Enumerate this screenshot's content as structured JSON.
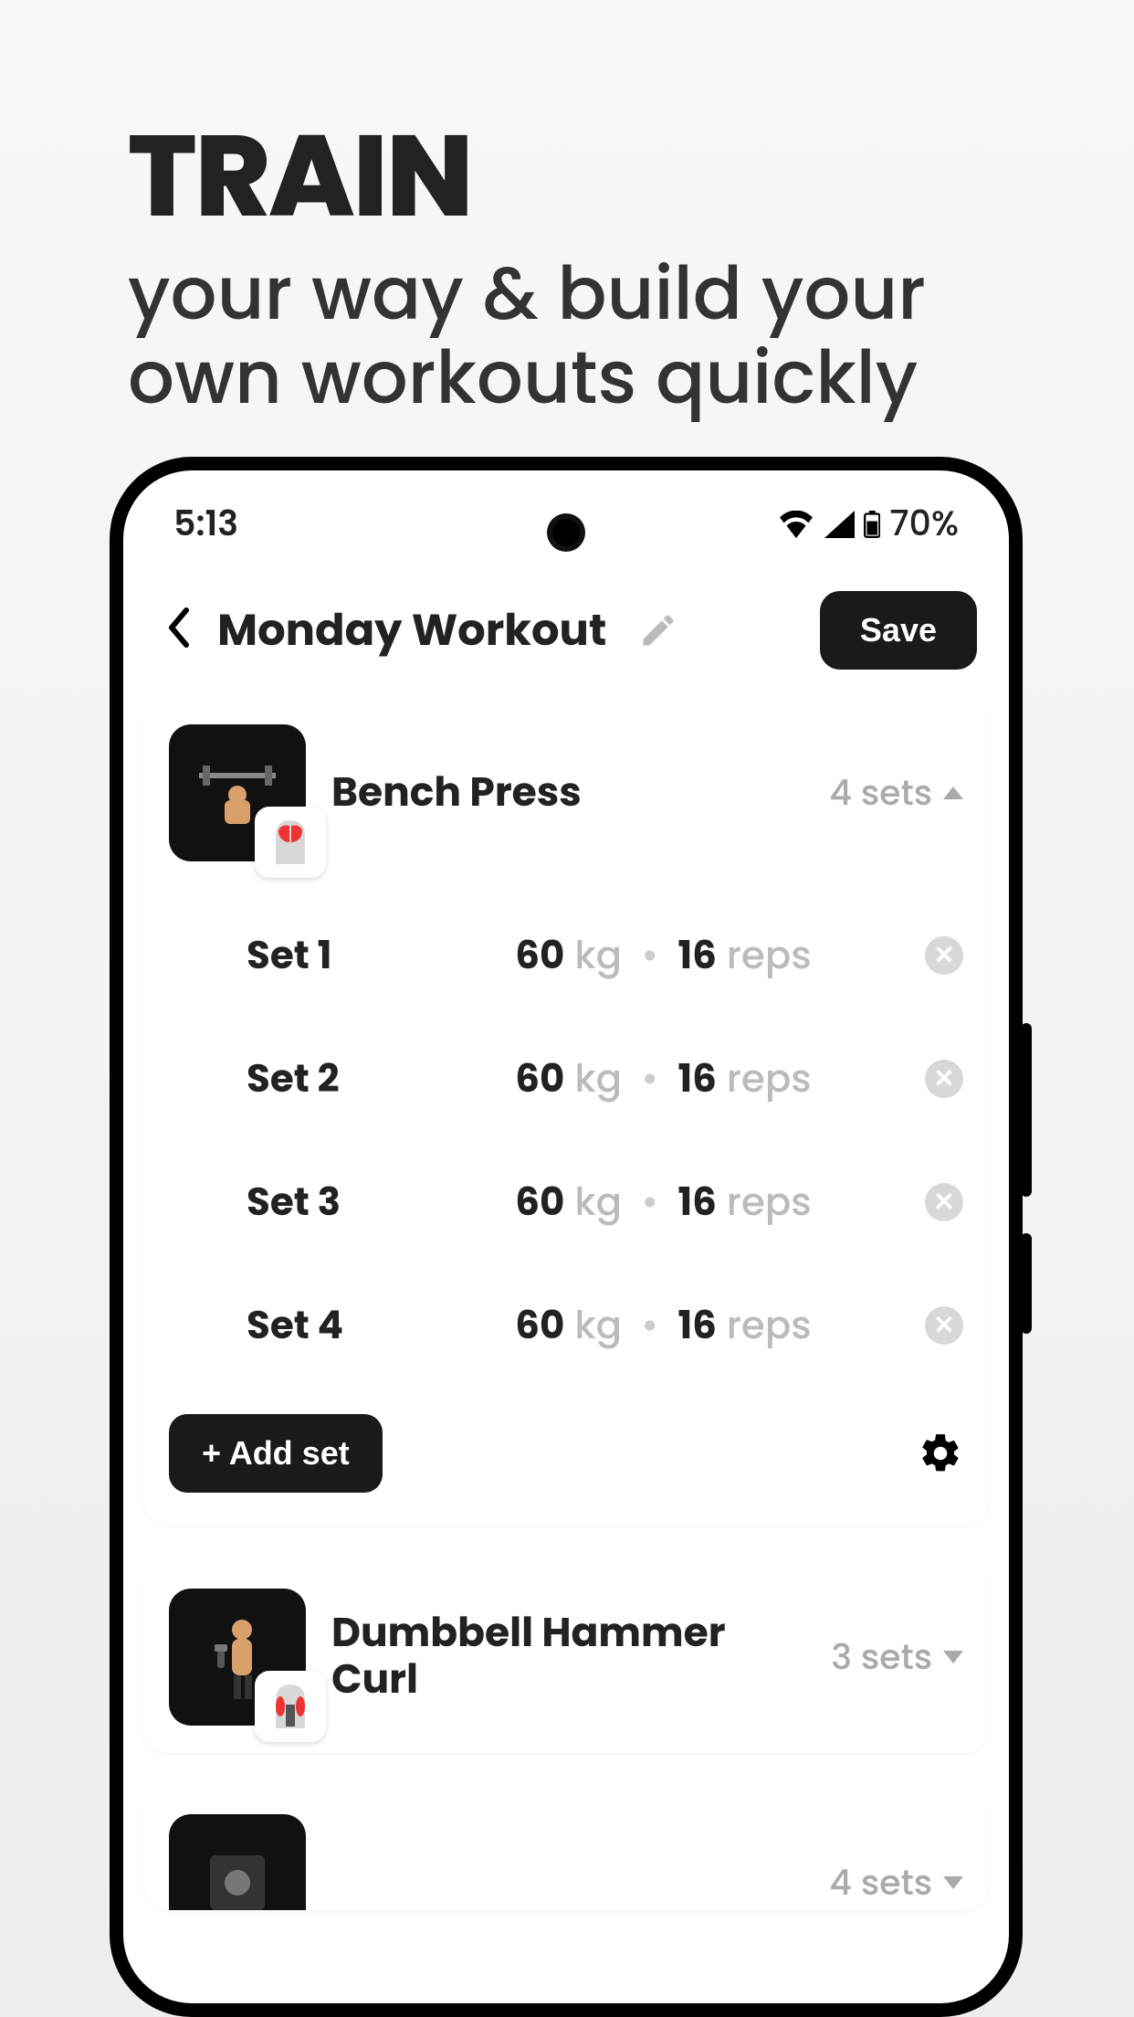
{
  "marketing": {
    "headline": "TRAIN",
    "subline": "your way & build your own workouts quickly"
  },
  "statusbar": {
    "time": "5:13",
    "battery": "70%"
  },
  "header": {
    "title": "Monday Workout",
    "save_label": "Save"
  },
  "exercises": [
    {
      "name": "Bench Press",
      "sets_label": "4 sets",
      "expanded": true,
      "sets": [
        {
          "label": "Set 1",
          "weight": "60",
          "weight_unit": "kg",
          "reps": "16",
          "reps_unit": "reps"
        },
        {
          "label": "Set 2",
          "weight": "60",
          "weight_unit": "kg",
          "reps": "16",
          "reps_unit": "reps"
        },
        {
          "label": "Set 3",
          "weight": "60",
          "weight_unit": "kg",
          "reps": "16",
          "reps_unit": "reps"
        },
        {
          "label": "Set 4",
          "weight": "60",
          "weight_unit": "kg",
          "reps": "16",
          "reps_unit": "reps"
        }
      ],
      "add_set_label": "+ Add set"
    },
    {
      "name": "Dumbbell Hammer Curl",
      "sets_label": "3 sets",
      "expanded": false
    },
    {
      "name": "",
      "sets_label": "4 sets",
      "expanded": false
    }
  ]
}
